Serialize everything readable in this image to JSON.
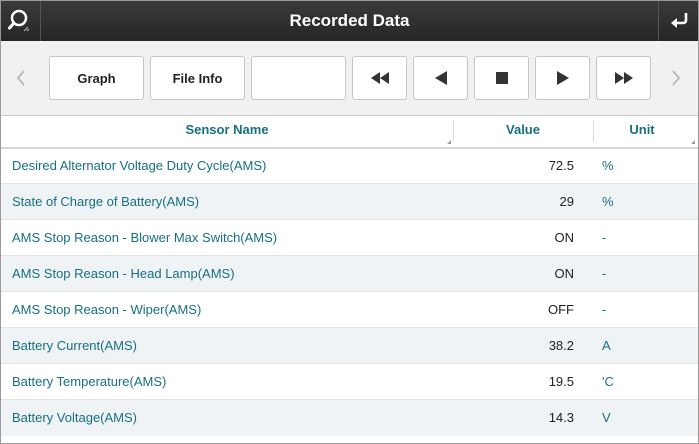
{
  "header": {
    "title": "Recorded Data",
    "search_icon": "search-icon",
    "back_icon": "return-arrow-icon"
  },
  "toolbar": {
    "graph_label": "Graph",
    "file_info_label": "File Info",
    "blank_label": "",
    "icons": [
      "chevron-left-icon",
      "fast-rewind-icon",
      "step-back-icon",
      "stop-icon",
      "play-icon",
      "fast-forward-icon",
      "chevron-right-icon"
    ]
  },
  "table": {
    "columns": {
      "sensor_name": "Sensor Name",
      "value": "Value",
      "unit": "Unit"
    },
    "rows": [
      {
        "name": "Desired Alternator Voltage Duty Cycle(AMS)",
        "value": "72.5",
        "unit": "%"
      },
      {
        "name": "State of Charge of Battery(AMS)",
        "value": "29",
        "unit": "%"
      },
      {
        "name": "AMS Stop Reason - Blower Max Switch(AMS)",
        "value": "ON",
        "unit": "-"
      },
      {
        "name": "AMS Stop Reason - Head Lamp(AMS)",
        "value": "ON",
        "unit": "-"
      },
      {
        "name": "AMS Stop Reason - Wiper(AMS)",
        "value": "OFF",
        "unit": "-"
      },
      {
        "name": "Battery Current(AMS)",
        "value": "38.2",
        "unit": "A"
      },
      {
        "name": "Battery Temperature(AMS)",
        "value": "19.5",
        "unit": "'C"
      },
      {
        "name": "Battery Voltage(AMS)",
        "value": "14.3",
        "unit": "V"
      }
    ]
  },
  "colors": {
    "titlebar": "#2e2e2e",
    "accent_text": "#17707f",
    "alt_row": "#eff3f5"
  }
}
